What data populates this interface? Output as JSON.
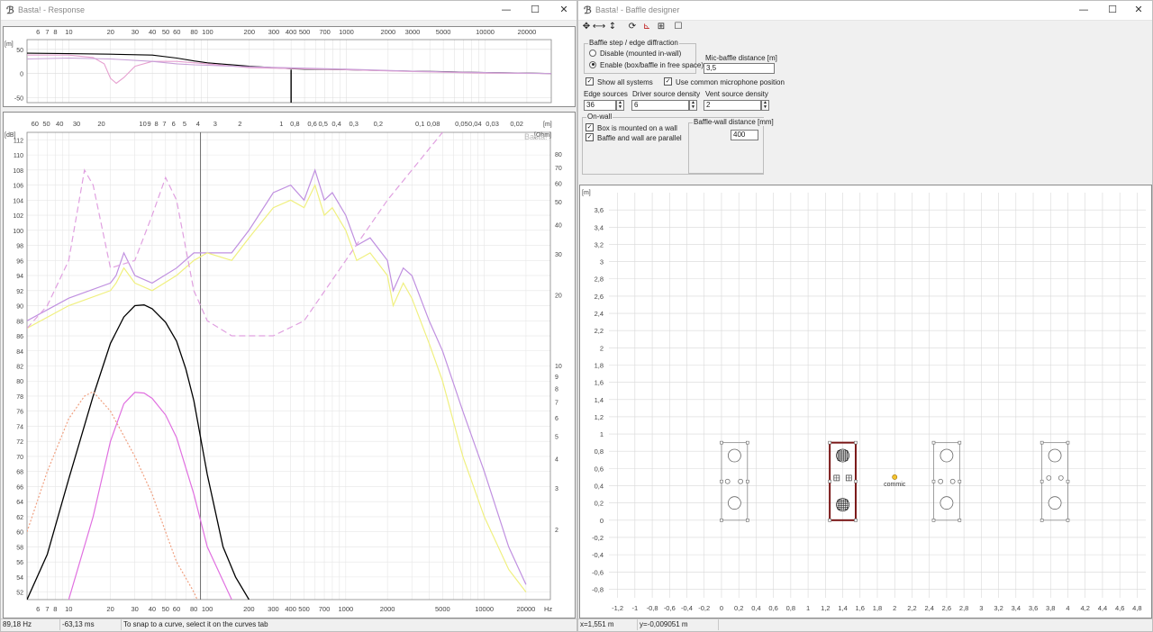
{
  "left_window": {
    "title": "Basta! - Response",
    "minimize": "—",
    "maximize": "☐",
    "close": "✕"
  },
  "right_window": {
    "title": "Basta! - Baffle designer",
    "minimize": "—",
    "maximize": "☐",
    "close": "✕",
    "toolbar": {
      "pan": "✥",
      "zoom_h": "⟷",
      "zoom_v": "↕",
      "tool4": "⟳",
      "tool5": "⊾",
      "tool6": "⊞",
      "tool7": "☐"
    },
    "diffraction_group": "Baffle step / edge diffraction",
    "radio_disable": "Disable (mounted in-wall)",
    "radio_enable": "Enable (box/baffle in free space)",
    "mic_distance_label": "Mic-baffle distance [m]",
    "mic_distance_value": "3,5",
    "show_all_systems": "Show all systems",
    "use_common_mic": "Use common microphone position",
    "edge_sources_label": "Edge sources",
    "edge_sources_value": "36",
    "driver_density_label": "Driver source density",
    "driver_density_value": "6",
    "vent_density_label": "Vent source density",
    "vent_density_value": "2",
    "onwall_group": "On-wall",
    "box_on_wall": "Box is mounted on a wall",
    "baffle_parallel": "Baffle and wall are parallel",
    "baffle_wall_group": "Baffle-wall distance [mm]",
    "baffle_wall_value": "400",
    "check_mark": "✓",
    "spin_up": "▲",
    "spin_down": "▼"
  },
  "response_top": {
    "unit_label": "[m]",
    "top_ticks": [
      {
        "label": "6",
        "f": 6
      },
      {
        "label": "7",
        "f": 7
      },
      {
        "label": "8",
        "f": 8
      },
      {
        "label": "10",
        "f": 10
      },
      {
        "label": "20",
        "f": 20
      },
      {
        "label": "30",
        "f": 30
      },
      {
        "label": "40",
        "f": 40
      },
      {
        "label": "50",
        "f": 50
      },
      {
        "label": "60",
        "f": 60
      },
      {
        "label": "80",
        "f": 80
      },
      {
        "label": "100",
        "f": 100
      },
      {
        "label": "200",
        "f": 200
      },
      {
        "label": "300",
        "f": 300
      },
      {
        "label": "400",
        "f": 400
      },
      {
        "label": "500",
        "f": 500
      },
      {
        "label": "700",
        "f": 700
      },
      {
        "label": "1000",
        "f": 1000
      },
      {
        "label": "2000",
        "f": 2000
      },
      {
        "label": "3000",
        "f": 3000
      },
      {
        "label": "5000",
        "f": 5000
      },
      {
        "label": "10000",
        "f": 10000
      },
      {
        "label": "20000",
        "f": 20000
      }
    ],
    "y_ticks": [
      {
        "label": "50",
        "v": 50
      },
      {
        "label": "0",
        "v": 0
      },
      {
        "label": "-50",
        "v": -50
      }
    ]
  },
  "main_chart": {
    "watermark": "Basta!",
    "ylabel_left": "[dB]",
    "ylabel_right": "[Ohm]",
    "distance_unit": "[m]",
    "hz_label": "Hz",
    "distance_ticks": [
      {
        "label": "60",
        "f": 5.7
      },
      {
        "label": "50",
        "f": 6.9
      },
      {
        "label": "40",
        "f": 8.6
      },
      {
        "label": "30",
        "f": 11.4
      },
      {
        "label": "20",
        "f": 17.2
      },
      {
        "label": "10",
        "f": 34.3
      },
      {
        "label": "9",
        "f": 38.1
      },
      {
        "label": "8",
        "f": 42.9
      },
      {
        "label": "7",
        "f": 49
      },
      {
        "label": "6",
        "f": 57.2
      },
      {
        "label": "5",
        "f": 68.6
      },
      {
        "label": "4",
        "f": 85.8
      },
      {
        "label": "3",
        "f": 114
      },
      {
        "label": "2",
        "f": 172
      },
      {
        "label": "1",
        "f": 343
      },
      {
        "label": "0,8",
        "f": 429
      },
      {
        "label": "0,6",
        "f": 572
      },
      {
        "label": "0,5",
        "f": 686
      },
      {
        "label": "0,4",
        "f": 858
      },
      {
        "label": "0,3",
        "f": 1143
      },
      {
        "label": "0,2",
        "f": 1715
      },
      {
        "label": "0,1",
        "f": 3430
      },
      {
        "label": "0,08",
        "f": 4288
      },
      {
        "label": "0,05",
        "f": 6860
      },
      {
        "label": "0,04",
        "f": 8575
      },
      {
        "label": "0,03",
        "f": 11433
      },
      {
        "label": "0,02",
        "f": 17150
      }
    ],
    "freq_ticks": [
      {
        "label": "6",
        "f": 6
      },
      {
        "label": "7",
        "f": 7
      },
      {
        "label": "8",
        "f": 8
      },
      {
        "label": "10",
        "f": 10
      },
      {
        "label": "20",
        "f": 20
      },
      {
        "label": "30",
        "f": 30
      },
      {
        "label": "40",
        "f": 40
      },
      {
        "label": "50",
        "f": 50
      },
      {
        "label": "60",
        "f": 60
      },
      {
        "label": "80",
        "f": 80
      },
      {
        "label": "100",
        "f": 100
      },
      {
        "label": "200",
        "f": 200
      },
      {
        "label": "300",
        "f": 300
      },
      {
        "label": "400",
        "f": 400
      },
      {
        "label": "500",
        "f": 500
      },
      {
        "label": "700",
        "f": 700
      },
      {
        "label": "1000",
        "f": 1000
      },
      {
        "label": "2000",
        "f": 2000
      },
      {
        "label": "5000",
        "f": 5000
      },
      {
        "label": "10000",
        "f": 10000
      },
      {
        "label": "20000",
        "f": 20000
      }
    ],
    "db_ticks": [
      "112",
      "110",
      "108",
      "106",
      "104",
      "102",
      "100",
      "98",
      "96",
      "94",
      "92",
      "90",
      "88",
      "86",
      "84",
      "82",
      "80",
      "78",
      "76",
      "74",
      "72",
      "70",
      "68",
      "66",
      "64",
      "62",
      "60",
      "58",
      "56",
      "54",
      "52"
    ],
    "ohm_ticks": [
      {
        "label": "80",
        "v": 80
      },
      {
        "label": "70",
        "v": 70
      },
      {
        "label": "60",
        "v": 60
      },
      {
        "label": "50",
        "v": 50
      },
      {
        "label": "40",
        "v": 40
      },
      {
        "label": "30",
        "v": 30
      },
      {
        "label": "20",
        "v": 20
      },
      {
        "label": "10",
        "v": 10
      },
      {
        "label": "9",
        "v": 9
      },
      {
        "label": "8",
        "v": 8
      },
      {
        "label": "7",
        "v": 7
      },
      {
        "label": "6",
        "v": 6
      },
      {
        "label": "5",
        "v": 5
      },
      {
        "label": "4",
        "v": 4
      },
      {
        "label": "3",
        "v": 3
      },
      {
        "label": "2",
        "v": 2
      }
    ]
  },
  "left_status": {
    "freq": "89,18 Hz",
    "time": "-63,13 ms",
    "hint": "To snap to a curve, select it on the curves tab"
  },
  "right_status": {
    "x": "x=1,551 m",
    "y": "y=-0,009051 m"
  },
  "baffle_chart": {
    "unit": "[m]",
    "mic_label": "commic",
    "x_ticks": [
      "-1,2",
      "-1",
      "-0,8",
      "-0,6",
      "-0,4",
      "-0,2",
      "0",
      "0,2",
      "0,4",
      "0,6",
      "0,8",
      "1",
      "1,2",
      "1,4",
      "1,6",
      "1,8",
      "2",
      "2,2",
      "2,4",
      "2,6",
      "2,8",
      "3",
      "3,2",
      "3,4",
      "3,6",
      "3,8",
      "4",
      "4,2",
      "4,4",
      "4,6",
      "4,8"
    ],
    "y_ticks": [
      "3,6",
      "3,4",
      "3,2",
      "3",
      "2,8",
      "2,6",
      "2,4",
      "2,2",
      "2",
      "1,8",
      "1,6",
      "1,4",
      "1,2",
      "1",
      "0,8",
      "0,6",
      "0,4",
      "0,2",
      "0",
      "-0,2",
      "-0,4",
      "-0,6",
      "-0,8"
    ]
  },
  "chart_data": [
    {
      "type": "line",
      "title": "",
      "xlabel": "Hz",
      "ylabel": "[m]",
      "xscale": "log",
      "xlim": [
        5,
        30000
      ],
      "ylim": [
        -60,
        70
      ],
      "grid": true,
      "series": [
        {
          "color": "#000000",
          "x": [
            5,
            10,
            20,
            40,
            60,
            80,
            100,
            200,
            300,
            400,
            500,
            1000,
            2000,
            3000,
            5000,
            10000,
            20000,
            30000
          ],
          "y": [
            42,
            41,
            40,
            38,
            32,
            26,
            22,
            15,
            12,
            10,
            9,
            8,
            6,
            5,
            4,
            2,
            1,
            0
          ]
        },
        {
          "color": "#e6a0d0",
          "x": [
            5,
            10,
            15,
            18,
            20,
            22,
            25,
            30,
            40,
            60,
            100,
            200,
            1000,
            3000,
            10000,
            30000
          ],
          "y": [
            38,
            38,
            33,
            20,
            -10,
            -20,
            -8,
            15,
            25,
            25,
            20,
            12,
            8,
            4,
            1,
            0
          ]
        },
        {
          "color": "#c8a0d8",
          "x": [
            5,
            10,
            20,
            40,
            60,
            80,
            100,
            200,
            1000,
            3000,
            10000,
            30000
          ],
          "y": [
            30,
            32,
            30,
            25,
            20,
            18,
            17,
            14,
            9,
            5,
            2,
            0
          ]
        }
      ]
    },
    {
      "type": "line",
      "title": "",
      "xlabel": "Hz",
      "ylabel": "[dB]",
      "xscale": "log",
      "xlim": [
        5,
        30000
      ],
      "ylim": [
        51,
        113
      ],
      "legend": "none",
      "grid": true,
      "series": [
        {
          "color": "#000000",
          "x": [
            5,
            7,
            10,
            15,
            20,
            25,
            30,
            35,
            40,
            50,
            60,
            70,
            80,
            100,
            130,
            160,
            200
          ],
          "y": [
            51,
            57,
            67,
            78,
            85,
            88.5,
            90,
            90.1,
            89.6,
            87.8,
            85.3,
            81.6,
            77.4,
            67.6,
            58,
            54,
            51
          ]
        },
        {
          "color": "#c090e0",
          "x": [
            5,
            10,
            20,
            22,
            25,
            30,
            40,
            60,
            80,
            100,
            150,
            200,
            300,
            400,
            500,
            600,
            700,
            800,
            1000,
            1200,
            1500,
            2000,
            2200,
            2600,
            3000,
            4000,
            5000,
            7000,
            10000,
            15000,
            20000
          ],
          "y": [
            88,
            91,
            93,
            94,
            97,
            94,
            93,
            95,
            97,
            97,
            97,
            100,
            105,
            106,
            104,
            108,
            104,
            105,
            102,
            98,
            99,
            96,
            92,
            95,
            94,
            88,
            84,
            76,
            68,
            58,
            53
          ]
        },
        {
          "color": "#f0f080",
          "x": [
            5,
            10,
            20,
            22,
            25,
            30,
            40,
            60,
            80,
            100,
            150,
            200,
            300,
            400,
            500,
            600,
            700,
            800,
            1000,
            1200,
            1500,
            2000,
            2200,
            2600,
            3000,
            4000,
            5000,
            7000,
            10000,
            15000,
            20000
          ],
          "y": [
            87,
            90,
            92,
            93,
            95,
            93,
            92,
            94,
            96,
            97,
            96,
            99,
            103,
            104,
            103,
            106,
            102,
            103,
            100,
            96,
            97,
            94,
            90,
            93,
            91,
            85,
            80,
            70,
            62,
            55,
            52
          ]
        },
        {
          "color": "#e0a0e0",
          "x": [
            5,
            7,
            10,
            13,
            15,
            20,
            30,
            40,
            50,
            60,
            80,
            100,
            150,
            200,
            300,
            500,
            1000,
            2000,
            5000
          ],
          "y": [
            87,
            90,
            96,
            108,
            106,
            95,
            96,
            102,
            107,
            104,
            92,
            88,
            86,
            86,
            86,
            88,
            96,
            104,
            113
          ]
        },
        {
          "color": "#e070e0",
          "x": [
            10,
            15,
            20,
            25,
            30,
            35,
            40,
            50,
            60,
            80,
            100,
            150,
            200
          ],
          "y": [
            51,
            62,
            72,
            77,
            78.5,
            78.4,
            77.7,
            75.5,
            72.5,
            65,
            58,
            51,
            48
          ]
        },
        {
          "color": "#f0a080",
          "x": [
            5,
            7,
            10,
            13,
            15,
            20,
            30,
            40,
            50,
            60,
            80,
            100
          ],
          "y": [
            60,
            68,
            75,
            78,
            78.6,
            76,
            70,
            65,
            60,
            56,
            52,
            48
          ]
        }
      ]
    },
    {
      "type": "scatter",
      "title": "",
      "xlabel": "",
      "ylabel": "[m]",
      "xlim": [
        -1.3,
        4.9
      ],
      "ylim": [
        -0.9,
        3.8
      ],
      "grid": true,
      "boxes": [
        {
          "x0": 0,
          "x1": 0.3,
          "y0": 0,
          "y1": 0.9,
          "selected": false
        },
        {
          "x0": 1.25,
          "x1": 1.55,
          "y0": 0,
          "y1": 0.9,
          "selected": true
        },
        {
          "x0": 2.45,
          "x1": 2.75,
          "y0": 0,
          "y1": 0.9,
          "selected": false
        },
        {
          "x0": 3.7,
          "x1": 4.0,
          "y0": 0,
          "y1": 0.9,
          "selected": false
        }
      ],
      "drivers": [
        {
          "x": 0.15,
          "y": 0.75
        },
        {
          "x": 0.15,
          "y": 0.2
        },
        {
          "x": 1.4,
          "y": 0.75
        },
        {
          "x": 1.4,
          "y": 0.18
        },
        {
          "x": 2.6,
          "y": 0.75
        },
        {
          "x": 2.6,
          "y": 0.2
        },
        {
          "x": 3.85,
          "y": 0.75
        },
        {
          "x": 3.85,
          "y": 0.2
        }
      ],
      "vents": [
        {
          "x": 0.07,
          "y": 0.45
        },
        {
          "x": 0.22,
          "y": 0.45
        },
        {
          "x": 1.33,
          "y": 0.49
        },
        {
          "x": 1.47,
          "y": 0.49
        },
        {
          "x": 2.53,
          "y": 0.45
        },
        {
          "x": 2.67,
          "y": 0.45
        },
        {
          "x": 3.78,
          "y": 0.49
        },
        {
          "x": 3.92,
          "y": 0.49
        }
      ],
      "mic": {
        "x": 2.0,
        "y": 0.5
      }
    }
  ]
}
